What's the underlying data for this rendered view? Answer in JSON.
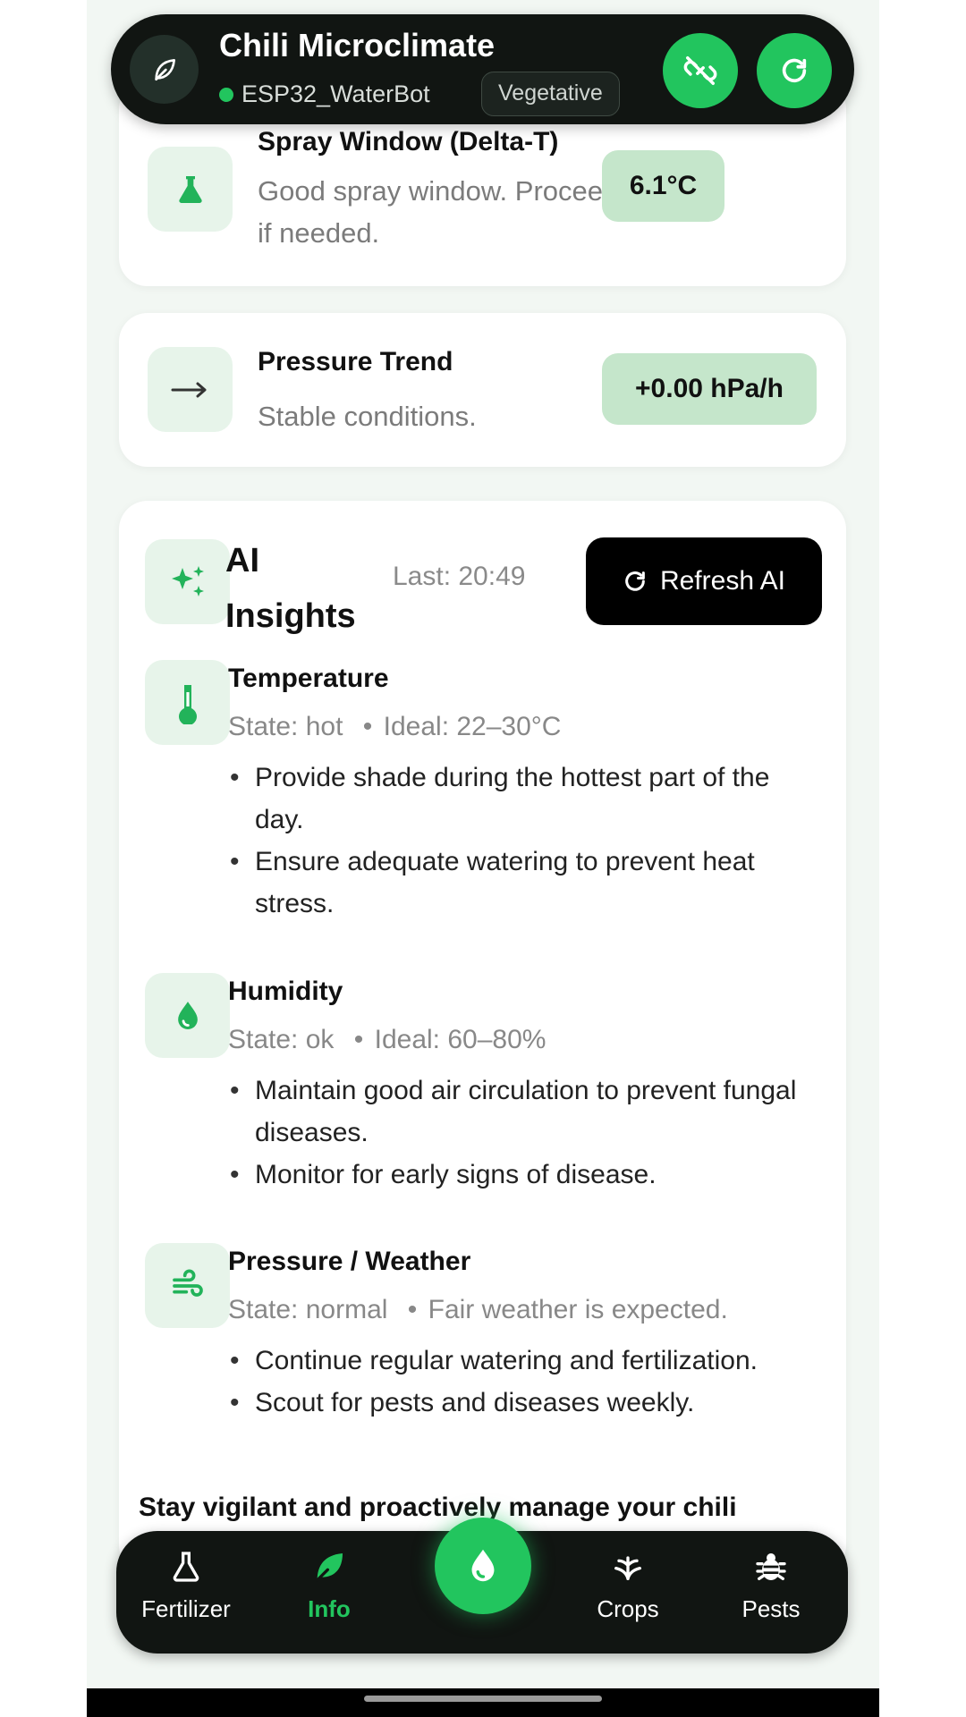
{
  "header": {
    "title": "Chili Microclimate",
    "device": "ESP32_WaterBot",
    "stage": "Vegetative",
    "icons": {
      "logo": "leaf-icon",
      "disconnect": "link-off-icon",
      "refresh": "refresh-icon"
    }
  },
  "spray_window": {
    "title": "Spray Window (Delta-T)",
    "message": "Good spray window. Proceed if needed.",
    "value": "6.1°C",
    "icon": "flask-icon"
  },
  "pressure_trend": {
    "title": "Pressure Trend",
    "message": "Stable conditions.",
    "value": "+0.00 hPa/h",
    "icon": "arrow-right-icon"
  },
  "ai_insights": {
    "title": "AI Insights",
    "last_updated": "Last: 20:49",
    "refresh_label": "Refresh AI",
    "icon": "sparkles-icon",
    "sections": [
      {
        "title": "Temperature",
        "state": "State: hot",
        "ideal": "Ideal: 22–30°C",
        "icon": "thermometer-icon",
        "bullets": [
          "Provide shade during the hottest part of the day.",
          "Ensure adequate watering to prevent heat stress."
        ]
      },
      {
        "title": "Humidity",
        "state": "State: ok",
        "ideal": "Ideal: 60–80%",
        "icon": "water-drop-icon",
        "bullets": [
          "Maintain good air circulation to prevent fungal diseases.",
          "Monitor for early signs of disease."
        ]
      },
      {
        "title": "Pressure / Weather",
        "state": "State: normal",
        "ideal": "Fair weather is expected.",
        "icon": "wind-icon",
        "bullets": [
          "Continue regular watering and fertilization.",
          "Scout for pests and diseases weekly."
        ]
      }
    ],
    "closing": "Stay vigilant and proactively manage your chili"
  },
  "nav": {
    "items": [
      {
        "label": "Fertilizer",
        "icon": "flask-icon"
      },
      {
        "label": "Info",
        "icon": "leaf-icon",
        "active": true
      },
      {
        "label": "Crops",
        "icon": "sprout-icon"
      },
      {
        "label": "Pests",
        "icon": "bug-icon"
      }
    ],
    "center_icon": "water-drop-icon"
  },
  "colors": {
    "accent": "#22c55e",
    "chip": "#c5e6cb",
    "tile": "#e7f4ea",
    "dark": "#111512"
  }
}
